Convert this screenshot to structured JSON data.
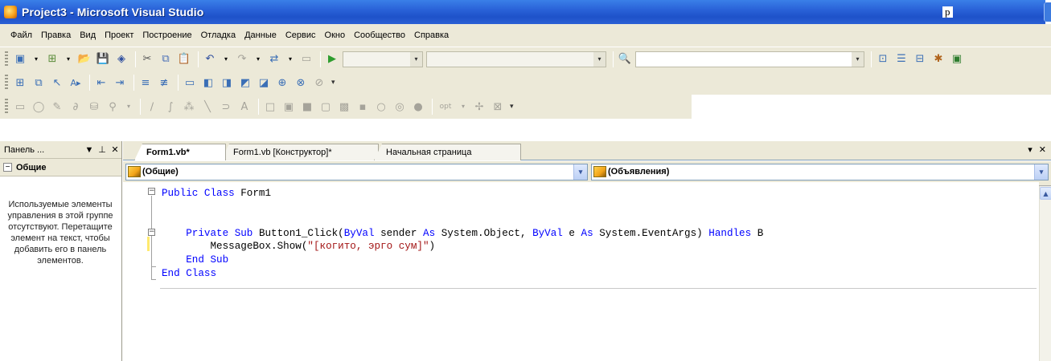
{
  "window": {
    "title": "Project3 - Microsoft Visual Studio",
    "overlay_text_1": "",
    "overlay_text_2": "р"
  },
  "menu": [
    "Файл",
    "Правка",
    "Вид",
    "Проект",
    "Построение",
    "Отладка",
    "Данные",
    "Сервис",
    "Окно",
    "Сообщество",
    "Справка"
  ],
  "toolbar": {
    "config_combo": "",
    "platform_combo": ""
  },
  "toolbox": {
    "title": "Панель ...",
    "pin_symbol": "▼ ⊥ ✕",
    "section": "Общие",
    "section_toggle": "−",
    "empty_message": "Используемые элементы управления в этой группе отсутствуют. Перетащите элемент на текст, чтобы добавить его в панель элементов."
  },
  "tabs": [
    {
      "label": "Form1.vb*",
      "active": true
    },
    {
      "label": "Form1.vb [Конструктор]*",
      "active": false
    },
    {
      "label": "Начальная страница",
      "active": false
    }
  ],
  "tabs_controls": "▾ ✕",
  "editor": {
    "class_combo": "(Общие)",
    "member_combo": "(Объявления)",
    "code": [
      {
        "indent": "",
        "tokens": [
          {
            "t": "Public Class ",
            "c": "kw"
          },
          {
            "t": "Form1",
            "c": "plain"
          }
        ]
      },
      {
        "indent": "",
        "tokens": []
      },
      {
        "indent": "    ",
        "tokens": [
          {
            "t": "Private Sub ",
            "c": "kw"
          },
          {
            "t": "Button1_Click(",
            "c": "plain"
          },
          {
            "t": "ByVal",
            "c": "kw"
          },
          {
            "t": " sender ",
            "c": "plain"
          },
          {
            "t": "As",
            "c": "kw"
          },
          {
            "t": " System.Object, ",
            "c": "plain"
          },
          {
            "t": "ByVal",
            "c": "kw"
          },
          {
            "t": " e ",
            "c": "plain"
          },
          {
            "t": "As",
            "c": "kw"
          },
          {
            "t": " System.EventArgs) ",
            "c": "plain"
          },
          {
            "t": "Handles",
            "c": "kw"
          },
          {
            "t": " B",
            "c": "plain"
          }
        ]
      },
      {
        "indent": "        ",
        "tokens": [
          {
            "t": "MessageBox.Show(",
            "c": "plain"
          },
          {
            "t": "\"[когито, эрго сум]\"",
            "c": "str"
          },
          {
            "t": ")",
            "c": "plain"
          }
        ]
      },
      {
        "indent": "    ",
        "tokens": [
          {
            "t": "End Sub",
            "c": "kw"
          }
        ]
      },
      {
        "indent": "",
        "tokens": [
          {
            "t": "End Class",
            "c": "kw"
          }
        ]
      }
    ]
  },
  "colors": {
    "titlebar": "#2a62d8",
    "chrome": "#ece9d8",
    "keyword": "#0000ff",
    "string": "#a31515"
  }
}
